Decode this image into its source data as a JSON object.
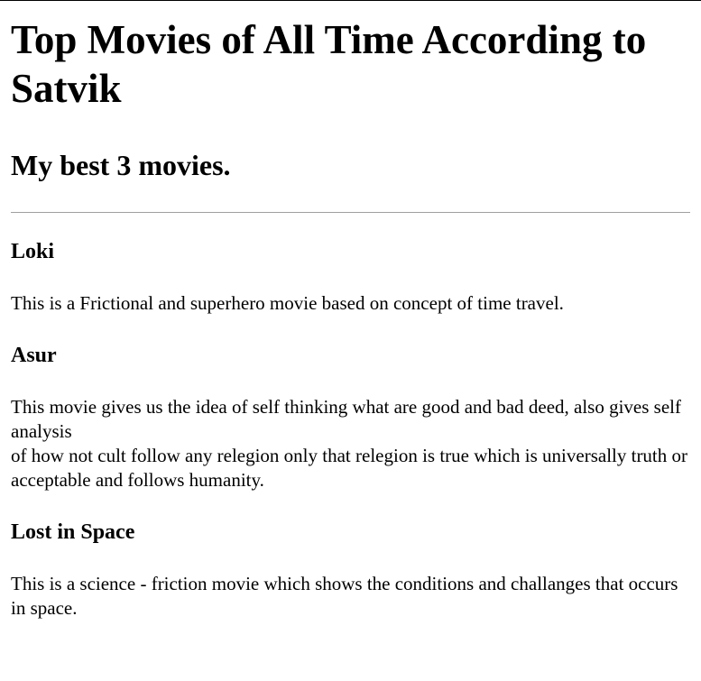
{
  "page": {
    "title": "Top Movies of All Time According to Satvik",
    "subtitle": "My best 3 movies."
  },
  "movies": [
    {
      "title": "Loki",
      "description_lines": [
        "This is a Frictional and superhero movie based on concept of time travel."
      ]
    },
    {
      "title": "Asur",
      "description_lines": [
        "This movie gives us the idea of self thinking what are good and bad deed, also gives self analysis",
        "of how not cult follow any relegion only that relegion is true which is universally truth or",
        "acceptable and follows humanity."
      ]
    },
    {
      "title": "Lost in Space",
      "description_lines": [
        "This is a science - friction movie which shows the conditions and challanges that occurs in space."
      ]
    }
  ]
}
